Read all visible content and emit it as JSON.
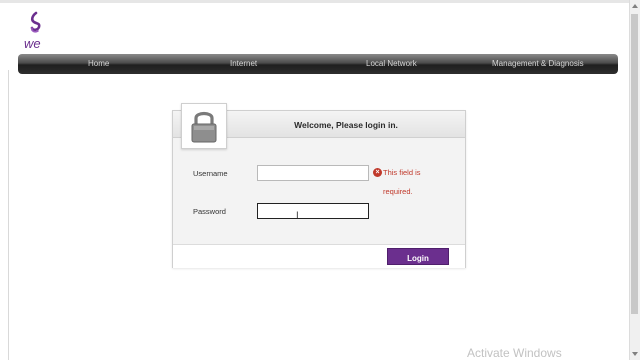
{
  "brand": {
    "logo_text": "we",
    "accent_color": "#6b2f8e"
  },
  "nav": {
    "items": [
      {
        "label": "Home"
      },
      {
        "label": "Internet"
      },
      {
        "label": "Local Network"
      },
      {
        "label": "Management & Diagnosis"
      }
    ]
  },
  "login": {
    "title": "Welcome, Please login in.",
    "icon": "padlock-icon",
    "username": {
      "label": "Username",
      "value": "",
      "placeholder": ""
    },
    "password": {
      "label": "Password",
      "value": "",
      "placeholder": ""
    },
    "error": {
      "icon": "error-x-icon",
      "line1": "This field is",
      "line2": "required.",
      "color": "#c0392b"
    },
    "button_label": "Login"
  },
  "overlay": {
    "watermark": "Activate Windows"
  }
}
